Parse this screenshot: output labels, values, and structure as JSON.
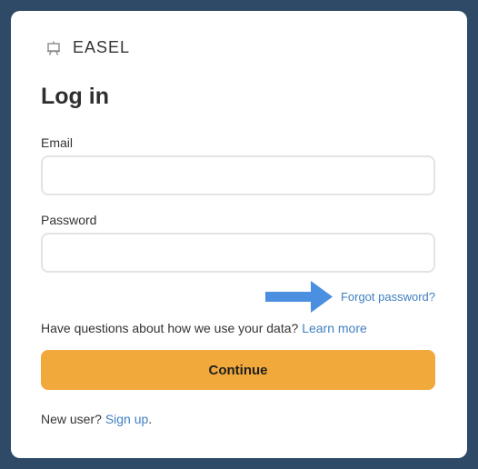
{
  "brand": {
    "name": "EASEL",
    "icon": "easel-icon"
  },
  "form": {
    "title": "Log in",
    "email_label": "Email",
    "email_value": "",
    "password_label": "Password",
    "password_value": "",
    "forgot_password": "Forgot password?",
    "data_question": "Have questions about how we use your data?",
    "learn_more": "Learn more",
    "continue_label": "Continue",
    "new_user": "New user?",
    "sign_up": "Sign up",
    "sign_up_suffix": "."
  },
  "annotation": {
    "arrow_icon": "arrow-right-icon",
    "arrow_color": "#4a8fe0"
  },
  "colors": {
    "background": "#2e4a66",
    "accent_button": "#f2a93b",
    "link": "#3f7fc0"
  }
}
